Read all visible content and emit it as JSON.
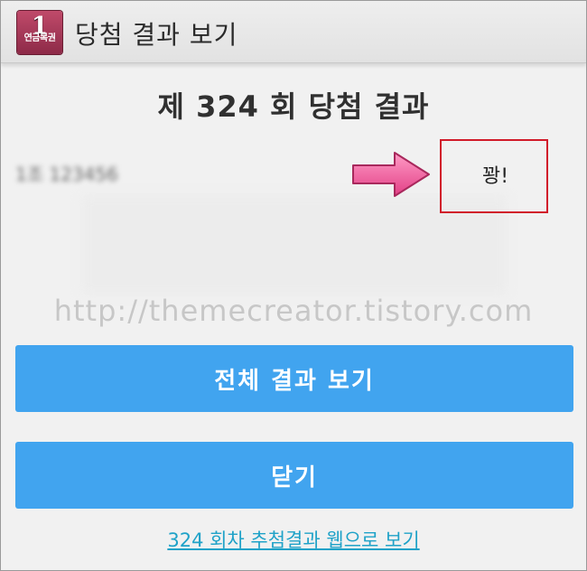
{
  "header": {
    "app_icon_number": "1",
    "app_icon_text": "연금복권",
    "title": "당첨 결과 보기"
  },
  "main": {
    "title": "제 324 회 당첨 결과",
    "ticket_number_blurred": "1조 123456",
    "result": "꽝!",
    "watermark": "http://themecreator.tistory.com"
  },
  "buttons": {
    "view_all_label": "전체 결과 보기",
    "close_label": "닫기"
  },
  "footer": {
    "web_link_label": "324 회차 추첨결과 웹으로 보기"
  },
  "colors": {
    "button_bg": "#41a4ef",
    "highlight_box": "#d11a2a",
    "arrow": "#f05a9a",
    "link": "#1fa2c8"
  }
}
